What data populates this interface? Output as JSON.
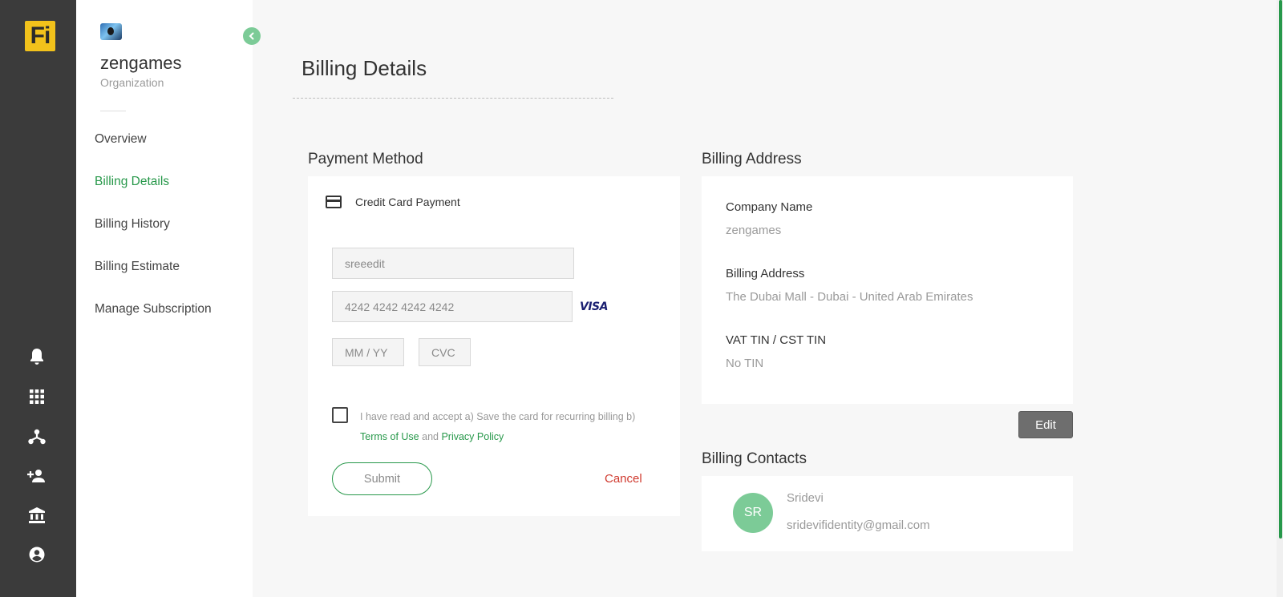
{
  "app": {
    "logo_text": "Fi"
  },
  "rail": {
    "icons": [
      "bell-icon",
      "apps-grid-icon",
      "hierarchy-icon",
      "add-user-icon",
      "bank-icon",
      "account-icon"
    ]
  },
  "sidebar": {
    "org_name": "zengames",
    "org_type": "Organization",
    "items": [
      {
        "label": "Overview"
      },
      {
        "label": "Billing Details"
      },
      {
        "label": "Billing History"
      },
      {
        "label": "Billing Estimate"
      },
      {
        "label": "Manage Subscription"
      }
    ],
    "active_item": "Billing Details"
  },
  "page": {
    "title": "Billing Details"
  },
  "payment": {
    "section_title": "Payment Method",
    "method_label": "Credit Card Payment",
    "name_value": "sreeedit",
    "card_number_value": "4242 4242 4242 4242",
    "card_brand": "VISA",
    "expiry_placeholder": "MM / YY",
    "cvc_placeholder": "CVC",
    "terms_prefix": "I have read and accept a) Save the card for recurring billing b) ",
    "terms_link": "Terms of Use",
    "terms_and": " and ",
    "privacy_link": "Privacy Policy",
    "submit_label": "Submit",
    "cancel_label": "Cancel"
  },
  "billing_address": {
    "section_title": "Billing Address",
    "company_label": "Company Name",
    "company_value": "zengames",
    "address_label": "Billing Address",
    "address_value": "The Dubai Mall - Dubai - United Arab Emirates",
    "tin_label": "VAT TIN / CST TIN",
    "tin_value": "No TIN",
    "edit_label": "Edit"
  },
  "billing_contacts": {
    "section_title": "Billing Contacts",
    "contact": {
      "initials": "SR",
      "name": "Sridevi",
      "email": "sridevifidentity@gmail.com"
    }
  },
  "colors": {
    "accent": "#27984a",
    "avatar_green": "#7ccb97",
    "rail_bg": "#3b3b3b",
    "logo_yellow": "#f2c21b",
    "cancel_red": "#d03a2f"
  }
}
